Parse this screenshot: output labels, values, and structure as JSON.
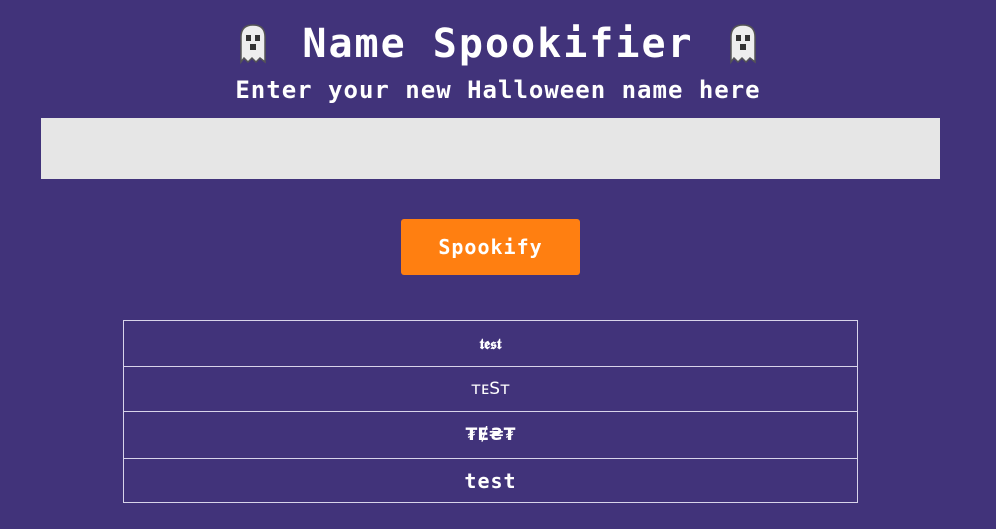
{
  "header": {
    "title": "Name Spookifier",
    "subtitle": "Enter your new Halloween name here",
    "icons": [
      "ghost-icon",
      "ghost-icon"
    ]
  },
  "form": {
    "input_value": "",
    "input_placeholder": "",
    "button_label": "Spookify"
  },
  "results": {
    "rows": [
      "𝖙𝖊𝖘𝖙",
      "ᴛᴇSᴛ",
      "₮Ɇ₴₮",
      "test"
    ]
  },
  "colors": {
    "background": "#41337a",
    "input_background": "#e6e6e6",
    "button": "#ff7f11",
    "text": "#ffffff"
  }
}
